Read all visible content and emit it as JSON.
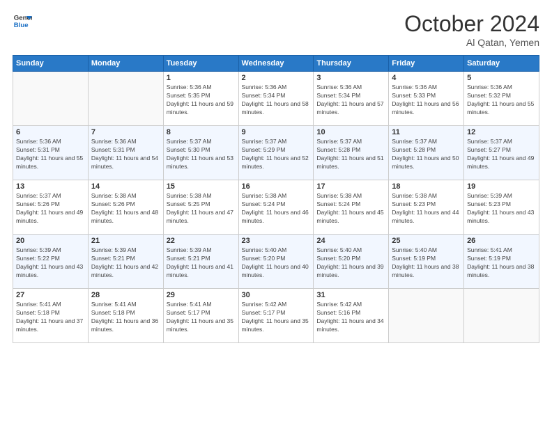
{
  "header": {
    "month_title": "October 2024",
    "location": "Al Qatan, Yemen",
    "logo_line1": "General",
    "logo_line2": "Blue"
  },
  "weekdays": [
    "Sunday",
    "Monday",
    "Tuesday",
    "Wednesday",
    "Thursday",
    "Friday",
    "Saturday"
  ],
  "weeks": [
    [
      {
        "day": "",
        "info": ""
      },
      {
        "day": "",
        "info": ""
      },
      {
        "day": "1",
        "info": "Sunrise: 5:36 AM\nSunset: 5:35 PM\nDaylight: 11 hours and 59 minutes."
      },
      {
        "day": "2",
        "info": "Sunrise: 5:36 AM\nSunset: 5:34 PM\nDaylight: 11 hours and 58 minutes."
      },
      {
        "day": "3",
        "info": "Sunrise: 5:36 AM\nSunset: 5:34 PM\nDaylight: 11 hours and 57 minutes."
      },
      {
        "day": "4",
        "info": "Sunrise: 5:36 AM\nSunset: 5:33 PM\nDaylight: 11 hours and 56 minutes."
      },
      {
        "day": "5",
        "info": "Sunrise: 5:36 AM\nSunset: 5:32 PM\nDaylight: 11 hours and 55 minutes."
      }
    ],
    [
      {
        "day": "6",
        "info": "Sunrise: 5:36 AM\nSunset: 5:31 PM\nDaylight: 11 hours and 55 minutes."
      },
      {
        "day": "7",
        "info": "Sunrise: 5:36 AM\nSunset: 5:31 PM\nDaylight: 11 hours and 54 minutes."
      },
      {
        "day": "8",
        "info": "Sunrise: 5:37 AM\nSunset: 5:30 PM\nDaylight: 11 hours and 53 minutes."
      },
      {
        "day": "9",
        "info": "Sunrise: 5:37 AM\nSunset: 5:29 PM\nDaylight: 11 hours and 52 minutes."
      },
      {
        "day": "10",
        "info": "Sunrise: 5:37 AM\nSunset: 5:28 PM\nDaylight: 11 hours and 51 minutes."
      },
      {
        "day": "11",
        "info": "Sunrise: 5:37 AM\nSunset: 5:28 PM\nDaylight: 11 hours and 50 minutes."
      },
      {
        "day": "12",
        "info": "Sunrise: 5:37 AM\nSunset: 5:27 PM\nDaylight: 11 hours and 49 minutes."
      }
    ],
    [
      {
        "day": "13",
        "info": "Sunrise: 5:37 AM\nSunset: 5:26 PM\nDaylight: 11 hours and 49 minutes."
      },
      {
        "day": "14",
        "info": "Sunrise: 5:38 AM\nSunset: 5:26 PM\nDaylight: 11 hours and 48 minutes."
      },
      {
        "day": "15",
        "info": "Sunrise: 5:38 AM\nSunset: 5:25 PM\nDaylight: 11 hours and 47 minutes."
      },
      {
        "day": "16",
        "info": "Sunrise: 5:38 AM\nSunset: 5:24 PM\nDaylight: 11 hours and 46 minutes."
      },
      {
        "day": "17",
        "info": "Sunrise: 5:38 AM\nSunset: 5:24 PM\nDaylight: 11 hours and 45 minutes."
      },
      {
        "day": "18",
        "info": "Sunrise: 5:38 AM\nSunset: 5:23 PM\nDaylight: 11 hours and 44 minutes."
      },
      {
        "day": "19",
        "info": "Sunrise: 5:39 AM\nSunset: 5:23 PM\nDaylight: 11 hours and 43 minutes."
      }
    ],
    [
      {
        "day": "20",
        "info": "Sunrise: 5:39 AM\nSunset: 5:22 PM\nDaylight: 11 hours and 43 minutes."
      },
      {
        "day": "21",
        "info": "Sunrise: 5:39 AM\nSunset: 5:21 PM\nDaylight: 11 hours and 42 minutes."
      },
      {
        "day": "22",
        "info": "Sunrise: 5:39 AM\nSunset: 5:21 PM\nDaylight: 11 hours and 41 minutes."
      },
      {
        "day": "23",
        "info": "Sunrise: 5:40 AM\nSunset: 5:20 PM\nDaylight: 11 hours and 40 minutes."
      },
      {
        "day": "24",
        "info": "Sunrise: 5:40 AM\nSunset: 5:20 PM\nDaylight: 11 hours and 39 minutes."
      },
      {
        "day": "25",
        "info": "Sunrise: 5:40 AM\nSunset: 5:19 PM\nDaylight: 11 hours and 38 minutes."
      },
      {
        "day": "26",
        "info": "Sunrise: 5:41 AM\nSunset: 5:19 PM\nDaylight: 11 hours and 38 minutes."
      }
    ],
    [
      {
        "day": "27",
        "info": "Sunrise: 5:41 AM\nSunset: 5:18 PM\nDaylight: 11 hours and 37 minutes."
      },
      {
        "day": "28",
        "info": "Sunrise: 5:41 AM\nSunset: 5:18 PM\nDaylight: 11 hours and 36 minutes."
      },
      {
        "day": "29",
        "info": "Sunrise: 5:41 AM\nSunset: 5:17 PM\nDaylight: 11 hours and 35 minutes."
      },
      {
        "day": "30",
        "info": "Sunrise: 5:42 AM\nSunset: 5:17 PM\nDaylight: 11 hours and 35 minutes."
      },
      {
        "day": "31",
        "info": "Sunrise: 5:42 AM\nSunset: 5:16 PM\nDaylight: 11 hours and 34 minutes."
      },
      {
        "day": "",
        "info": ""
      },
      {
        "day": "",
        "info": ""
      }
    ]
  ]
}
